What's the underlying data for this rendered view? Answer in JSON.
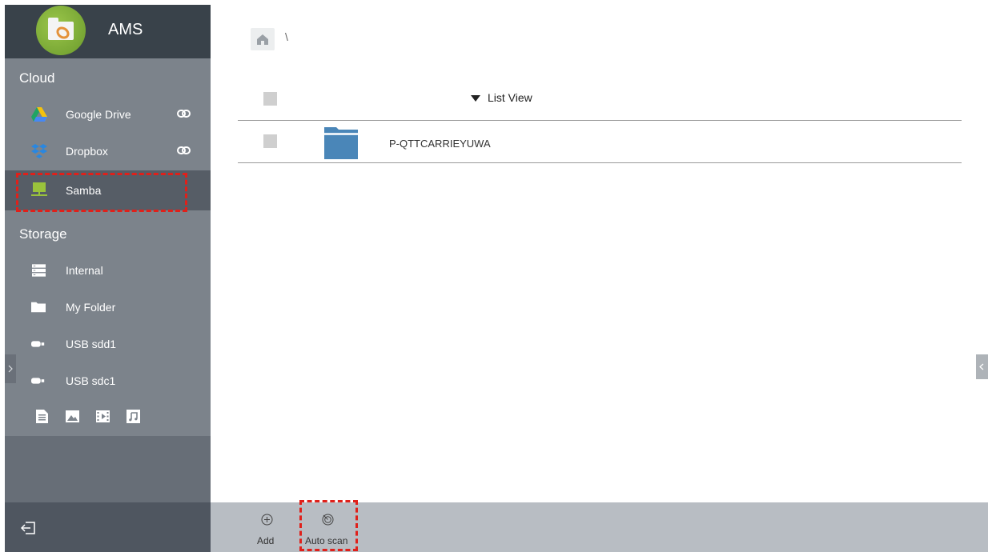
{
  "app": {
    "title": "AMS"
  },
  "sidebar": {
    "cloud_label": "Cloud",
    "cloud_items": [
      {
        "label": "Google Drive",
        "icon": "google-drive-icon",
        "linked": true
      },
      {
        "label": "Dropbox",
        "icon": "dropbox-icon",
        "linked": true
      },
      {
        "label": "Samba",
        "icon": "samba-icon",
        "selected": true
      }
    ],
    "storage_label": "Storage",
    "storage_items": [
      {
        "label": "Internal",
        "icon": "internal-storage-icon"
      },
      {
        "label": "My Folder",
        "icon": "folder-icon"
      },
      {
        "label": "USB sdd1",
        "icon": "usb-icon"
      },
      {
        "label": "USB sdc1",
        "icon": "usb-icon"
      }
    ],
    "media_filters": [
      "document-icon",
      "image-icon",
      "video-icon",
      "music-icon"
    ]
  },
  "breadcrumb": {
    "separator": "\\"
  },
  "file_list": {
    "view_toggle_label": "List View",
    "rows": [
      {
        "name": "P-QTTCARRIEYUWA",
        "type": "folder"
      }
    ]
  },
  "toolbar": {
    "add_label": "Add",
    "auto_scan_label": "Auto scan"
  },
  "colors": {
    "sidebar_bg": "#7c838b",
    "sidebar_header": "#39424a",
    "selected_item": "#565d66",
    "toolbar_bg": "#b8bdc3",
    "highlight": "#e0201a",
    "folder_blue": "#4a86b8"
  }
}
